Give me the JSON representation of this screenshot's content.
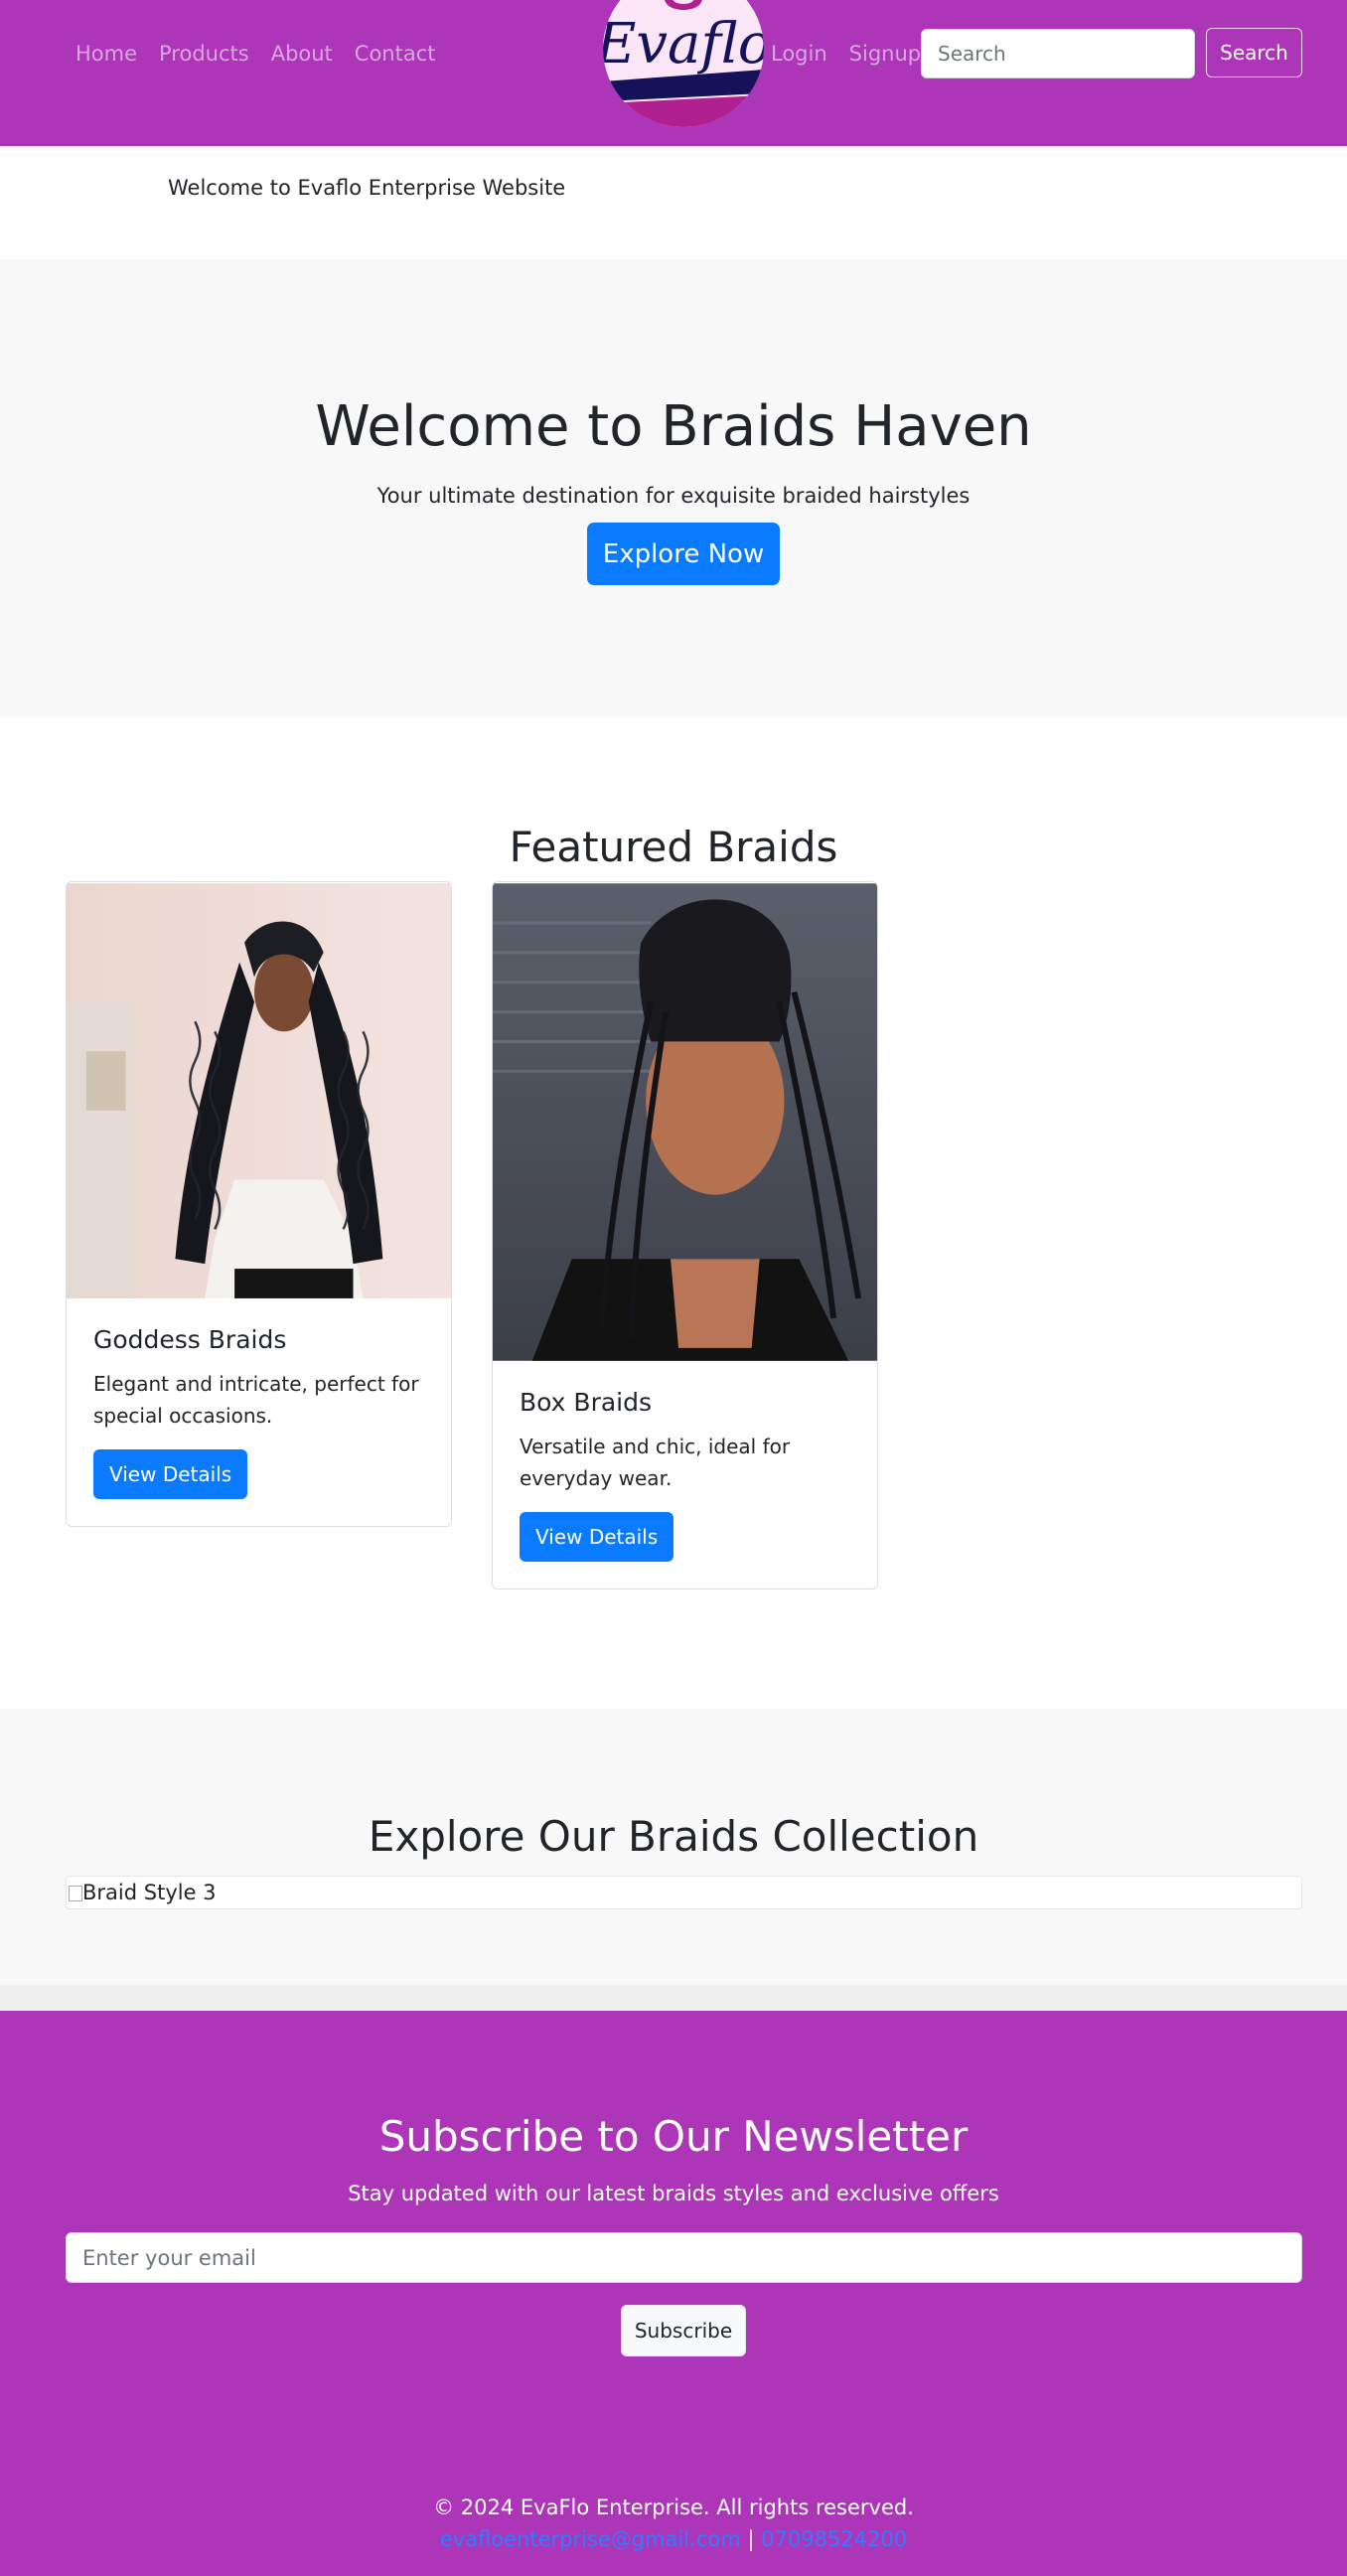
{
  "nav": {
    "left_links": [
      "Home",
      "Products",
      "About",
      "Contact"
    ],
    "logo_text": "Evaflo",
    "right_links": [
      "Login",
      "Signup"
    ],
    "search_placeholder": "Search",
    "search_button": "Search"
  },
  "welcome_bar": {
    "text": "Welcome to Evaflo Enterprise Website"
  },
  "hero": {
    "title": "Welcome to Braids Haven",
    "subtitle": "Your ultimate destination for exquisite braided hairstyles",
    "cta": "Explore Now"
  },
  "featured": {
    "title": "Featured Braids",
    "cards": [
      {
        "title": "Goddess Braids",
        "text": "Elegant and intricate, perfect for special occasions.",
        "button": "View Details"
      },
      {
        "title": "Box Braids",
        "text": "Versatile and chic, ideal for everyday wear.",
        "button": "View Details"
      }
    ]
  },
  "collection": {
    "title": "Explore Our Braids Collection",
    "broken_image_alt": "Braid Style 3"
  },
  "newsletter": {
    "title": "Subscribe to Our Newsletter",
    "subtitle": "Stay updated with our latest braids styles and exclusive offers",
    "email_placeholder": "Enter your email",
    "button": "Subscribe"
  },
  "footer": {
    "copyright": "© 2024 EvaFlo Enterprise. All rights reserved.",
    "email": "evafloenterprise@gmail.com",
    "separator": " | ",
    "phone": "07098524200"
  },
  "colors": {
    "brand_purple": "#ad35b8",
    "primary_blue": "#0a7bff",
    "light_gray": "#f8f8f8"
  }
}
